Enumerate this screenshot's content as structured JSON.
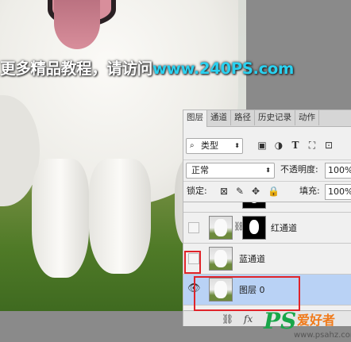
{
  "watermark": {
    "text": "更多精品教程，请访问",
    "url": "www.240PS.com"
  },
  "panel": {
    "tabs": [
      "图层",
      "通道",
      "路径",
      "历史记录",
      "动作"
    ],
    "filter": {
      "label": "类型"
    },
    "blend_mode": "正常",
    "opacity_label": "不透明度:",
    "opacity_value": "100%",
    "lock_label": "锁定:",
    "fill_label": "填充:",
    "fill_value": "100%",
    "layers": [
      {
        "name": "红通道",
        "visible": false,
        "has_mask": true,
        "selected": false
      },
      {
        "name": "蓝通道",
        "visible": false,
        "has_mask": false,
        "selected": false
      },
      {
        "name": "图层 0",
        "visible": true,
        "has_mask": false,
        "selected": true
      }
    ],
    "bottom_icons": [
      "link-icon",
      "fx-icon"
    ]
  },
  "logo": {
    "ps": "PS",
    "cn": "爱好者",
    "url": "www.psahz.com"
  },
  "colors": {
    "selection": "#b9d2f5",
    "highlight_box": "#e0242a",
    "watermark_url": "#2ad1f0"
  }
}
